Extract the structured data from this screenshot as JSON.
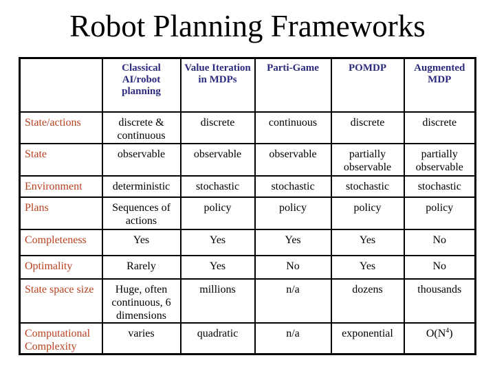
{
  "title": "Robot Planning Frameworks",
  "colors": {
    "header_text": "#2b2b7d",
    "row_label_text": "#b8401f",
    "cell_text": "#000000",
    "border": "#000000"
  },
  "table": {
    "corner": "",
    "columns": [
      "Classical AI/robot planning",
      "Value Iteration in MDPs",
      "Parti-Game",
      "POMDP",
      "Augmented MDP"
    ],
    "rows": [
      {
        "label": "State/actions",
        "cells": [
          "discrete & continuous",
          "discrete",
          "continuous",
          "discrete",
          "discrete"
        ]
      },
      {
        "label": "State",
        "cells": [
          "observable",
          "observable",
          "observable",
          "partially observable",
          "partially observable"
        ]
      },
      {
        "label": "Environment",
        "cells": [
          "deterministic",
          "stochastic",
          "stochastic",
          "stochastic",
          "stochastic"
        ]
      },
      {
        "label": "Plans",
        "cells": [
          "Sequences of actions",
          "policy",
          "policy",
          "policy",
          "policy"
        ]
      },
      {
        "label": "Completeness",
        "cells": [
          "Yes",
          "Yes",
          "Yes",
          "Yes",
          "No"
        ]
      },
      {
        "label": "Optimality",
        "cells": [
          "Rarely",
          "Yes",
          "No",
          "Yes",
          "No"
        ]
      },
      {
        "label": "State space size",
        "cells": [
          "Huge, often continuous, 6 dimensions",
          "millions",
          "n/a",
          "dozens",
          "thousands"
        ]
      },
      {
        "label": "Computational Complexity",
        "cells": [
          "varies",
          "quadratic",
          "n/a",
          "exponential",
          "O(N"
        ]
      }
    ],
    "complexity_superscript": "4",
    "complexity_suffix": ")"
  }
}
